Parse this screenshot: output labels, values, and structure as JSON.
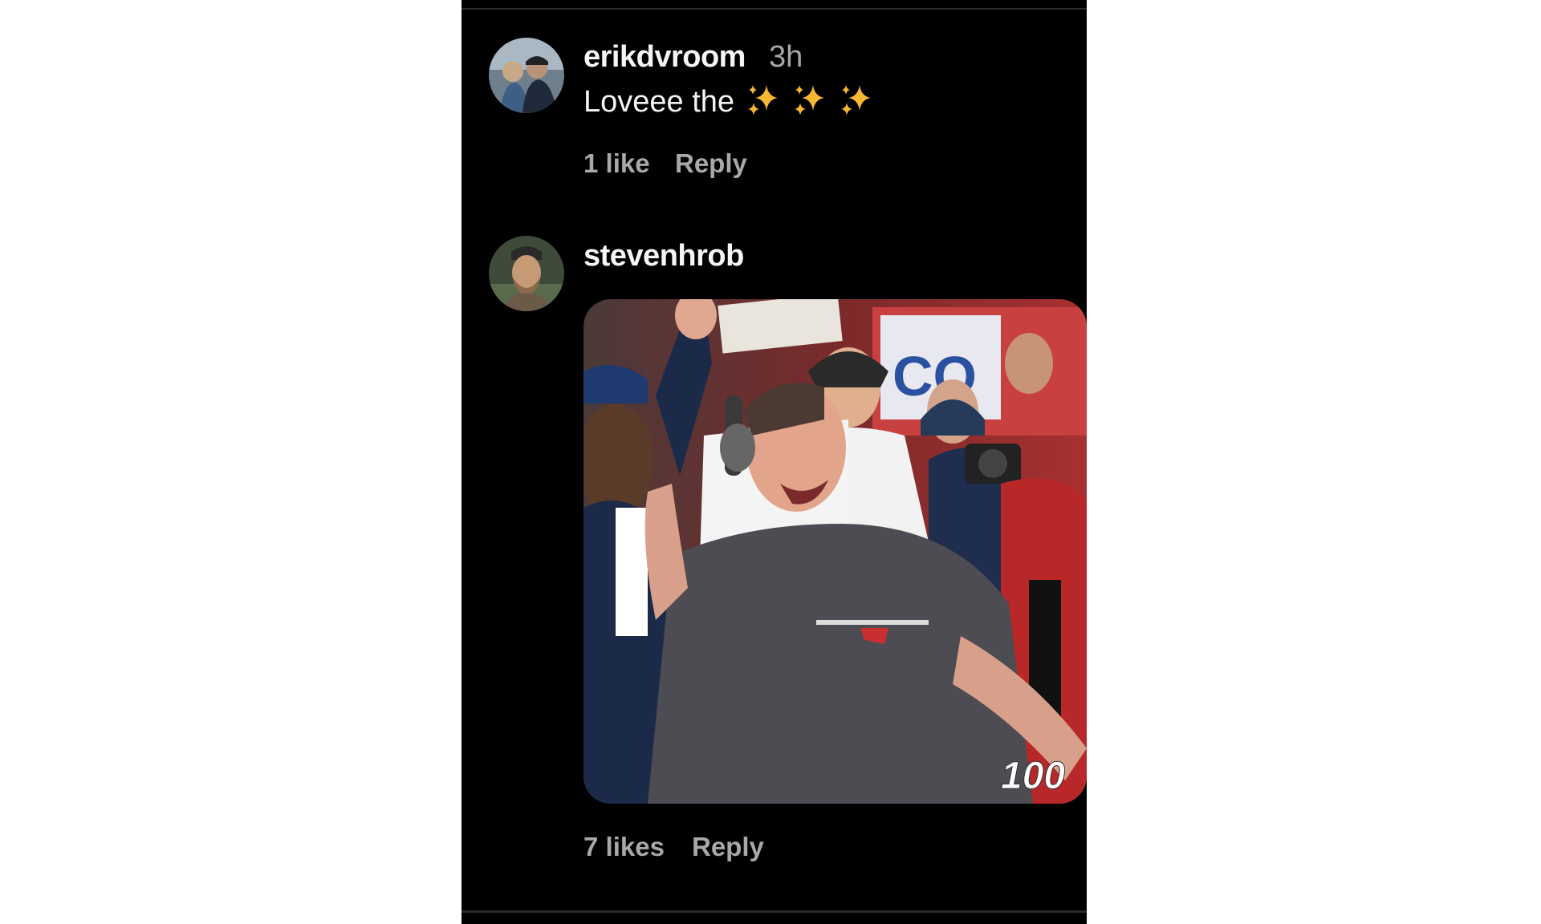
{
  "comments": [
    {
      "username": "erikdvroom",
      "time": "3h",
      "text": "Loveee the",
      "emoji": [
        "sparkles",
        "sparkles",
        "sparkles"
      ],
      "likes": "1 like",
      "reply": "Reply"
    },
    {
      "username": "stevenhrob",
      "gif_overlay": "100",
      "likes": "7 likes",
      "reply": "Reply"
    }
  ],
  "colors": {
    "background": "#000000",
    "primary_text": "#f5f5f5",
    "secondary_text": "#a8a8a8",
    "sparkle": "#f7b733"
  }
}
